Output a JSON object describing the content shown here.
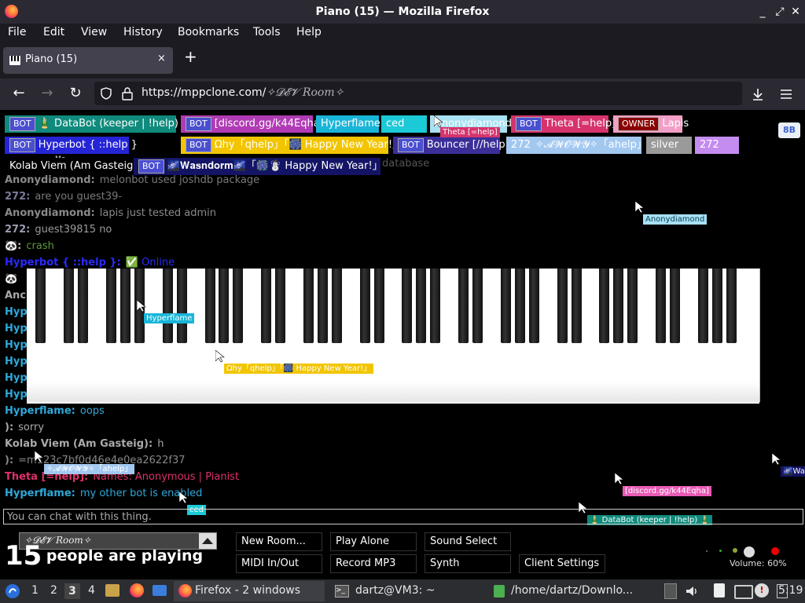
{
  "window": {
    "title": "Piano (15) — Mozilla Firefox"
  },
  "menu": [
    "File",
    "Edit",
    "View",
    "History",
    "Bookmarks",
    "Tools",
    "Help"
  ],
  "tab": {
    "label": "Piano (15)",
    "close": "×",
    "new": "+"
  },
  "nav": {
    "back": "←",
    "forward": "→",
    "reload": "↻",
    "url_main": "https://mppclone.com/",
    "url_room": "✧𝓓𝓔𝓥 Room✧"
  },
  "userlist": [
    {
      "text": "🎍 DataBot (keeper | !help) 🎍",
      "bot": true,
      "bg": "#0f8a7c",
      "fg": "#ffffff"
    },
    {
      "text": "[discord.gg/k44Eqha]",
      "bot": true,
      "bg": "#b03bb4",
      "fg": "#ffffff"
    },
    {
      "text": "Hyperflame",
      "bot": false,
      "bg": "#19b5d8",
      "fg": "#ffffff"
    },
    {
      "text": "ced",
      "bot": false,
      "bg": "#1cc9d6",
      "fg": "#ffffff"
    },
    {
      "text": "Anonydiamond",
      "bot": false,
      "bg": "#a7e1f2",
      "fg": "#ffffff"
    },
    {
      "text": "Theta [=help]",
      "bot": true,
      "bg": "#d6336c",
      "fg": "#ffffff"
    },
    {
      "text": "Lapis",
      "owner": true,
      "bg": "#f29fc6",
      "fg": "#ffffff"
    },
    {
      "text": "Hyperbot { ::help }",
      "bot": true,
      "bg": "#2525d6",
      "fg": "#ffffff"
    },
    {
      "text": "Ωhy「qhelp」「🎆 Happy New Year!」",
      "bot": true,
      "bg": "#f2c500",
      "fg": "#ffffff"
    },
    {
      "text": "Bouncer [//help]",
      "bot": true,
      "bg": "#3a2f99",
      "fg": "#ffffff"
    },
    {
      "text": "272",
      "tagtext": "✧𝓐𝓦𝓞𝓦𝓨✧「ahelp」",
      "bot": false,
      "bg": "#a3c8f0",
      "fg": "#ffffff"
    },
    {
      "text": "silver",
      "bot": false,
      "bg": "#9a9a9a",
      "fg": "#ffffff"
    },
    {
      "text": "272",
      "bot": false,
      "bg": "#c58cf0",
      "fg": "#ffffff"
    },
    {
      "text": "Kolab Viem (Am Gasteig)",
      "bot": false,
      "bg": "#000000",
      "fg": "#ffffff"
    },
    {
      "text": "🌌𝐖𝐚𝐬𝐧𝐝𝐨𝐫𝐦🌌「🎆☃️ Happy New Year!」",
      "bot": true,
      "bg": "#141466",
      "fg": "#ffffff"
    }
  ],
  "bot_badge": "BOT",
  "owner_badge": "OWNER",
  "small_me": "Me",
  "faded_top": "database",
  "chat": [
    {
      "name": "Anonydiamond:",
      "msg": "melonbot used joshdb package",
      "nc": "#8a8a8a",
      "mc": "#7a7a7a"
    },
    {
      "name": "272:",
      "msg": "are you guest39-",
      "nc": "#7a7a9a",
      "mc": "#7a7a7a"
    },
    {
      "name": "Anonydiamond:",
      "msg": "lapis just tested admin",
      "nc": "#8a8a8a",
      "mc": "#8a8a8a"
    },
    {
      "name": "272:",
      "msg": "guest39815 no",
      "nc": "#9a9ab0",
      "mc": "#9a9a9a"
    },
    {
      "name": "🐼:",
      "msg": "crash",
      "nc": "#bbbbbb",
      "mc": "#5a9a3a"
    },
    {
      "name": "Hyperbot { ::help }:",
      "msg": "✅ Online",
      "nc": "#2a2aff",
      "mc": "#2a2aff"
    }
  ],
  "chat_behind": [
    "🐼",
    "Anc",
    "Hyp",
    "Hyp",
    "Hyp",
    "Hyp",
    "Hyp",
    "Hyp"
  ],
  "chat_bottom": [
    {
      "name": "Hyperflame:",
      "msg": "oops",
      "nc": "#2fa8d8",
      "mc": "#2fa8d8"
    },
    {
      "name": "):",
      "msg": "sorry",
      "nc": "#aaaaaa",
      "mc": "#aaaaaa"
    },
    {
      "name": "Kolab Viem (Am Gasteig):",
      "msg": "h",
      "nc": "#aaaaaa",
      "mc": "#aaaaaa"
    },
    {
      "name": "):",
      "msg": "=m123c7bf0d46e4e0ea2622f37",
      "nc": "#888888",
      "mc": "#888888"
    },
    {
      "name": "Theta [=help]:",
      "msg": "Names: Anonymous | Pianist",
      "nc": "#e0306a",
      "mc": "#e0306a"
    },
    {
      "name": "Hyperflame:",
      "msg": "my other bot is enabled",
      "nc": "#2fa8d8",
      "mc": "#2fa8d8"
    }
  ],
  "cursors": [
    {
      "label": "Anonydiamond",
      "bg": "#a7e1f2",
      "fg": "#0b3c55"
    },
    {
      "label": "Hyperflame",
      "bg": "#19b5d8",
      "fg": "#ffffff"
    },
    {
      "label": "Ωhy「qhelp」「🎆 Happy New Year!」",
      "bg": "#f2c500",
      "fg": "#ffffff"
    },
    {
      "label": "✧𝓐𝓦𝓞𝓦𝓨✧「ahelp」",
      "bg": "#a3c8f0",
      "fg": "#ffffff"
    },
    {
      "label": "ced",
      "bg": "#1cc9d6",
      "fg": "#ffffff"
    },
    {
      "label": "[discord.gg/k44Eqha]",
      "bg": "#e85bb5",
      "fg": "#ffffff"
    },
    {
      "label": "🎍 DataBot (keeper | !help) 🎍",
      "bg": "#0f8a7c",
      "fg": "#ffffff"
    },
    {
      "label": "🌌Wa",
      "bg": "#141466",
      "fg": "#ffffff"
    },
    {
      "label": "Theta [=help]",
      "bg": "#d6336c",
      "fg": "#ffffff"
    }
  ],
  "chat_placeholder": "You can chat with this thing.",
  "room_select": "✧𝓓𝓔𝓥 Room✧",
  "count": {
    "number": "15",
    "text": "people are playing"
  },
  "buttons": {
    "new_room": "New Room...",
    "play_alone": "Play Alone",
    "sound_select": "Sound Select",
    "midi": "MIDI In/Out",
    "record": "Record MP3",
    "synth": "Synth",
    "client_settings": "Client Settings"
  },
  "volume": "Volume: 60%",
  "corner_btn": "8B",
  "taskbar": {
    "workspaces": [
      "1",
      "2",
      "3",
      "4"
    ],
    "active_ws": "3",
    "tasks": [
      "Firefox - 2 windows",
      "dartz@VM3: ~",
      "/home/dartz/Downlo..."
    ],
    "clock": "5:19"
  }
}
